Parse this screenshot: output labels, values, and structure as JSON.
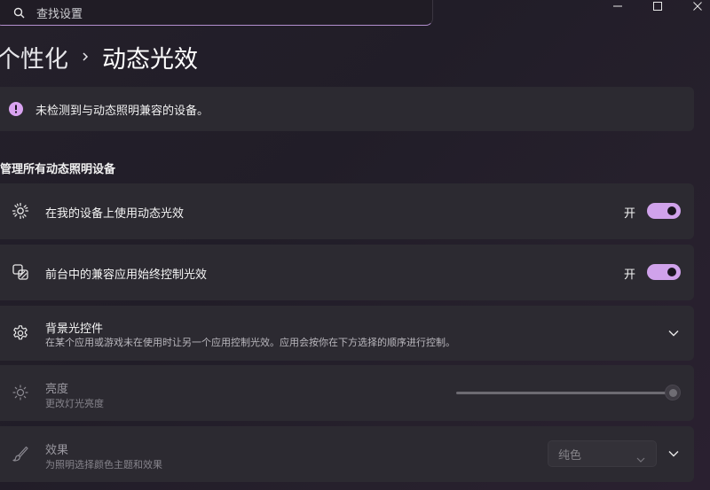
{
  "search": {
    "placeholder": "查找设置"
  },
  "window": {
    "minimize": "minimize",
    "maximize": "maximize",
    "close": "close"
  },
  "breadcrumb": {
    "parent": "个性化",
    "current": "动态光效"
  },
  "info_bar": {
    "text": "未检测到与动态照明兼容的设备。",
    "accent": "#d9a3f0"
  },
  "section": {
    "title": "管理所有动态照明设备"
  },
  "rows": [
    {
      "label": "在我的设备上使用动态光效",
      "state_text": "开",
      "on": true,
      "icon": "brightness-sun-icon"
    },
    {
      "label": "前台中的兼容应用始终控制光效",
      "state_text": "开",
      "on": true,
      "icon": "layered-apps-icon"
    },
    {
      "label": "背景光控件",
      "sub": "在某个应用或游戏未在使用时让另一个应用控制光效。应用会按你在下方选择的顺序进行控制。",
      "icon": "gear-icon"
    },
    {
      "label": "亮度",
      "sub": "更改灯光亮度",
      "slider_value": 1.0,
      "icon": "brightness-icon",
      "disabled": true
    },
    {
      "label": "效果",
      "sub": "为照明选择颜色主题和效果",
      "select_value": "纯色",
      "icon": "brush-icon",
      "disabled": true
    }
  ],
  "colors": {
    "accent": "#d0a2eb",
    "card": "#2c2a31",
    "background": "#221e28"
  }
}
